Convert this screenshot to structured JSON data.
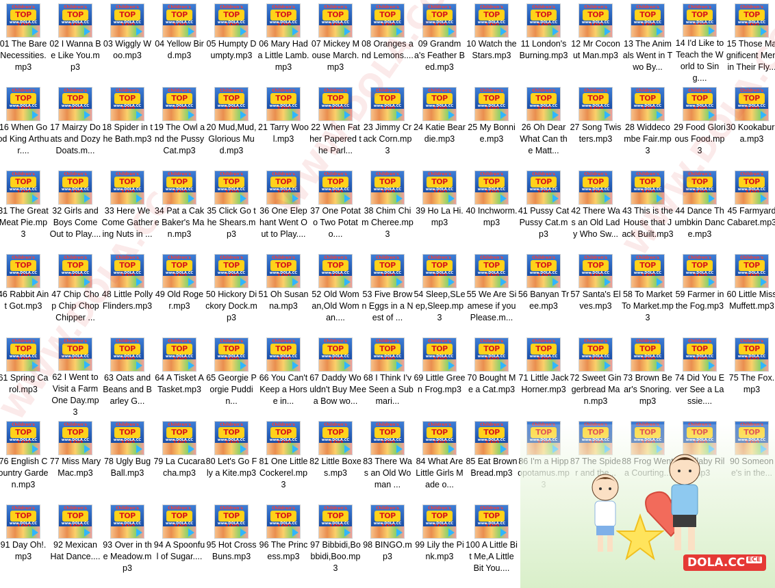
{
  "watermark": "WWW.DOLA.CC",
  "overlay_brand": {
    "name": "DOLA.CC",
    "tag": "ECE"
  },
  "thumbnail": {
    "top_text": "Children's",
    "number_text": "TOP 100",
    "www_text": "www.DOLA.CC"
  },
  "files": [
    "01 The Bare Necessities.mp3",
    "02 I Wanna Be Like You.mp3",
    "03 Wiggly Woo.mp3",
    "04 Yellow Bird.mp3",
    "05 Humpty Dumpty.mp3",
    "06 Mary Had a Little Lamb.mp3",
    "07 Mickey Mouse March.mp3",
    "08 Oranges and Lemons....",
    "09 Grandma's Feather Bed.mp3",
    "10 Watch the Stars.mp3",
    "11 London's Burning.mp3",
    "12 Mr Coconut Man.mp3",
    "13 The Animals Went in Two By...",
    "14 I'd Like to Teach the World to Sing....",
    "15 Those Magnificent Men in Their Fly...",
    "16 When Good King Arthur....",
    "17 Mairzy Doats and Dozy Doats.m...",
    "18 Spider in the Bath.mp3",
    "19 The Owl and the Pussy Cat.mp3",
    "20 Mud,Mud, Glorious Mud.mp3",
    "21 Tarry Wool.mp3",
    "22 When Father Papered the Parl...",
    "23 Jimmy Crack Corn.mp3",
    "24 Katie Beardie.mp3",
    "25 My Bonnie.mp3",
    "26 Oh Dear What Can the Matt...",
    "27 Song Twisters.mp3",
    "28 Widdecombe Fair.mp3",
    "29 Food Glorious Food.mp3",
    "30 Kookaburra.mp3",
    "31 The Great Meat Pie.mp3",
    "32 Girls and Boys Come Out to Play....",
    "33 Here We Come Gathering Nuts in ...",
    "34 Pat a Cake Baker's Man.mp3",
    "35 Click Go the Shears.mp3",
    "36 One Elephant Went Out to Play....",
    "37 One Potato Two Potato....",
    "38 Chim Chim Cheree.mp3",
    "39 Ho La Hi.mp3",
    "40 Inchworm.mp3",
    "41 Pussy Cat Pussy Cat.mp3",
    "42 There Was an Old Lady Who Sw...",
    "43 This is the House that Jack Built.mp3",
    "44 Dance Thumbkin Dance.mp3",
    "45 Farmyard Cabaret.mp3",
    "46 Rabbit Aint Got.mp3",
    "47 Chip Chop Chip Chop Chipper ...",
    "48 Little Polly Flinders.mp3",
    "49 Old Roger.mp3",
    "50 Hickory Dickory Dock.mp3",
    "51 Oh Susanna.mp3",
    "52 Old Woman,Old Woman....",
    "53 Five Brown Eggs in a Nest of ...",
    "54 Sleep,SLeep,Sleep.mp3",
    "55 We Are Siamese if you Please.m...",
    "56 Banyan Tree.mp3",
    "57 Santa's Elves.mp3",
    "58 To Market To Market.mp3",
    "59 Farmer in the Fog.mp3",
    "60 Little Miss Muffett.mp3",
    "61 Spring Carol.mp3",
    "62 I Went to Visit a Farm One Day.mp3",
    "63 Oats and Beans and Barley G...",
    "64 A Tisket A Tasket.mp3",
    "65 Georgie Porgie Puddin...",
    "66 You Can't Keep a Horse in...",
    "67 Daddy Wouldn't Buy Me a Bow wo...",
    "68 I Think I've Seen a Submari...",
    "69 Little Green Frog.mp3",
    "70 Bought Me a Cat.mp3",
    "71 Little Jack Horner.mp3",
    "72 Sweet Gingerbread Man.mp3",
    "73 Brown Bear's Snoring.mp3",
    "74 Did You Ever See a Lassie....",
    "75 The Fox.mp3",
    "76 English Country Garden.mp3",
    "77 Miss Mary Mac.mp3",
    "78 Ugly Bug Ball.mp3",
    "79 La Cucaracha.mp3",
    "80 Let's Go Fly a Kite.mp3",
    "81 One Little Cockerel.mp3",
    "82 Little Boxes.mp3",
    "83 There Was an Old Woman ...",
    "84 What Are Little Girls Made o...",
    "85 Eat Brown Bread.mp3",
    "86 I'm a Hippopotamus.mp3",
    "87 The Spider and the...",
    "88 Frog Went a Courting...",
    "89 Rillaby Rill.mp3",
    "90 Someone's in the...",
    "91 Day Oh!.mp3",
    "92 Mexican Hat Dance....",
    "93 Over in the Meadow.mp3",
    "94 A Spoonful of Sugar....",
    "95 Hot Cross Buns.mp3",
    "96 The Princess.mp3",
    "97 Bibbidi,Bobbidi,Boo.mp3",
    "98 BINGO.mp3",
    "99 Lily the Pink.mp3",
    "100 A Little Bit Me,A Little Bit You...."
  ]
}
